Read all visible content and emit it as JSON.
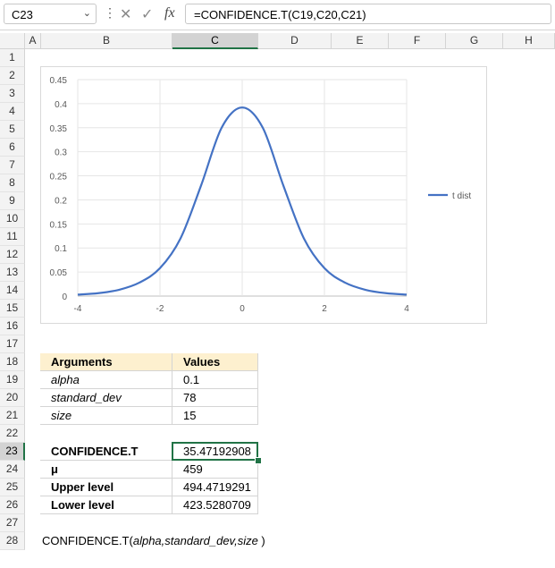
{
  "formula_bar": {
    "name_box": "C23",
    "formula": "=CONFIDENCE.T(C19,C20,C21)",
    "icons": [
      "chevron-down-icon",
      "more-icon",
      "cancel-icon",
      "enter-icon",
      "function-icon"
    ]
  },
  "columns": [
    "A",
    "B",
    "C",
    "D",
    "E",
    "F",
    "G",
    "H"
  ],
  "rows": [
    "1",
    "2",
    "3",
    "4",
    "5",
    "6",
    "7",
    "8",
    "9",
    "10",
    "11",
    "12",
    "13",
    "14",
    "15",
    "16",
    "17",
    "18",
    "19",
    "20",
    "21",
    "22",
    "23",
    "24",
    "25",
    "26",
    "27",
    "28"
  ],
  "selected": {
    "column": "C",
    "row": "23"
  },
  "args_table": {
    "headers": [
      "Arguments",
      "Values"
    ],
    "rows": [
      [
        "alpha",
        "0.1"
      ],
      [
        "standard_dev",
        "78"
      ],
      [
        "size",
        "15"
      ]
    ]
  },
  "results_table": {
    "rows": [
      [
        "CONFIDENCE.T",
        "35.47192908"
      ],
      [
        "μ",
        "459"
      ],
      [
        "Upper level",
        "494.4719291"
      ],
      [
        "Lower level",
        "423.5280709"
      ]
    ]
  },
  "syntax": {
    "fn": "CONFIDENCE.T(",
    "args": "alpha,standard_dev,size",
    "close": " )"
  },
  "colors": {
    "series": "#4472c4",
    "accent": "#217346",
    "header_fill": "#fdf0cf"
  },
  "chart_data": {
    "type": "line",
    "title": "",
    "legend": {
      "position": "right",
      "entries": [
        "t dist"
      ]
    },
    "xlim": [
      -4,
      4
    ],
    "ylim": [
      0,
      0.45
    ],
    "x_ticks": [
      "-4",
      "-2",
      "0",
      "2",
      "4"
    ],
    "y_ticks": [
      "0",
      "0.05",
      "0.1",
      "0.15",
      "0.2",
      "0.25",
      "0.3",
      "0.35",
      "0.4",
      "0.45"
    ],
    "grid": true,
    "series": [
      {
        "name": "t dist",
        "x": [
          -4,
          -3.5,
          -3,
          -2.5,
          -2,
          -1.5,
          -1,
          -0.5,
          0,
          0.5,
          1,
          1.5,
          2,
          2.5,
          3,
          3.5,
          4
        ],
        "y": [
          0.003,
          0.006,
          0.013,
          0.028,
          0.058,
          0.12,
          0.23,
          0.35,
          0.392,
          0.35,
          0.23,
          0.12,
          0.058,
          0.028,
          0.013,
          0.006,
          0.003
        ]
      }
    ]
  }
}
